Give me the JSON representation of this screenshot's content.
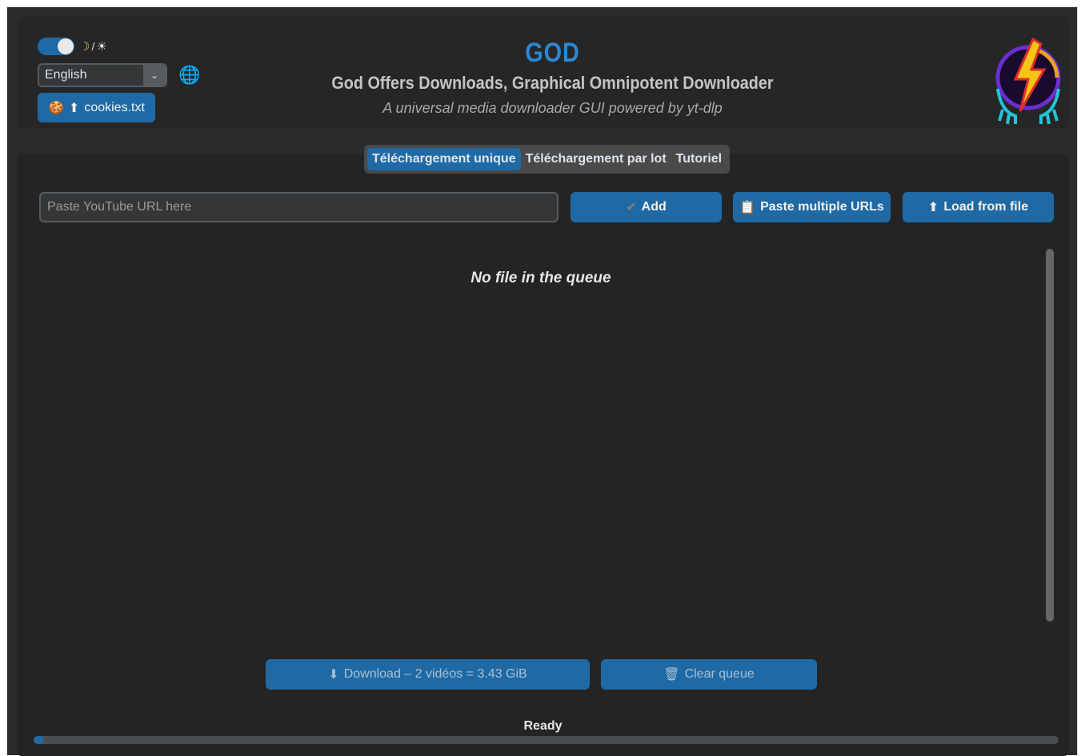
{
  "header": {
    "theme_toggle": {
      "on": true
    },
    "theme_icons": {
      "moon": "☽",
      "separator": "/",
      "sun": "☀"
    },
    "language": {
      "selected": "English"
    },
    "cookies_button": {
      "label": "cookies.txt"
    },
    "title": "GOD",
    "subtitle": "God Offers Downloads, Graphical Omnipotent Downloader",
    "tagline": "A universal media downloader GUI powered by yt-dlp"
  },
  "tabs": [
    {
      "label": "Téléchargement unique",
      "active": true
    },
    {
      "label": "Téléchargement par lot",
      "active": false
    },
    {
      "label": "Tutoriel",
      "active": false
    }
  ],
  "url_input": {
    "placeholder": "Paste YouTube URL here",
    "value": ""
  },
  "buttons": {
    "add": "Add",
    "paste_multiple": "Paste multiple URLs",
    "load_from_file": "Load from file",
    "download": "Download – 2 vidéos = 3.43 GiB",
    "clear_queue": "Clear queue"
  },
  "queue": {
    "empty_message": "No file in the queue"
  },
  "status": {
    "text": "Ready",
    "progress": 0.01
  },
  "colors": {
    "accent": "#1f6aa5",
    "title": "#2d86d0",
    "background": "#242424"
  }
}
